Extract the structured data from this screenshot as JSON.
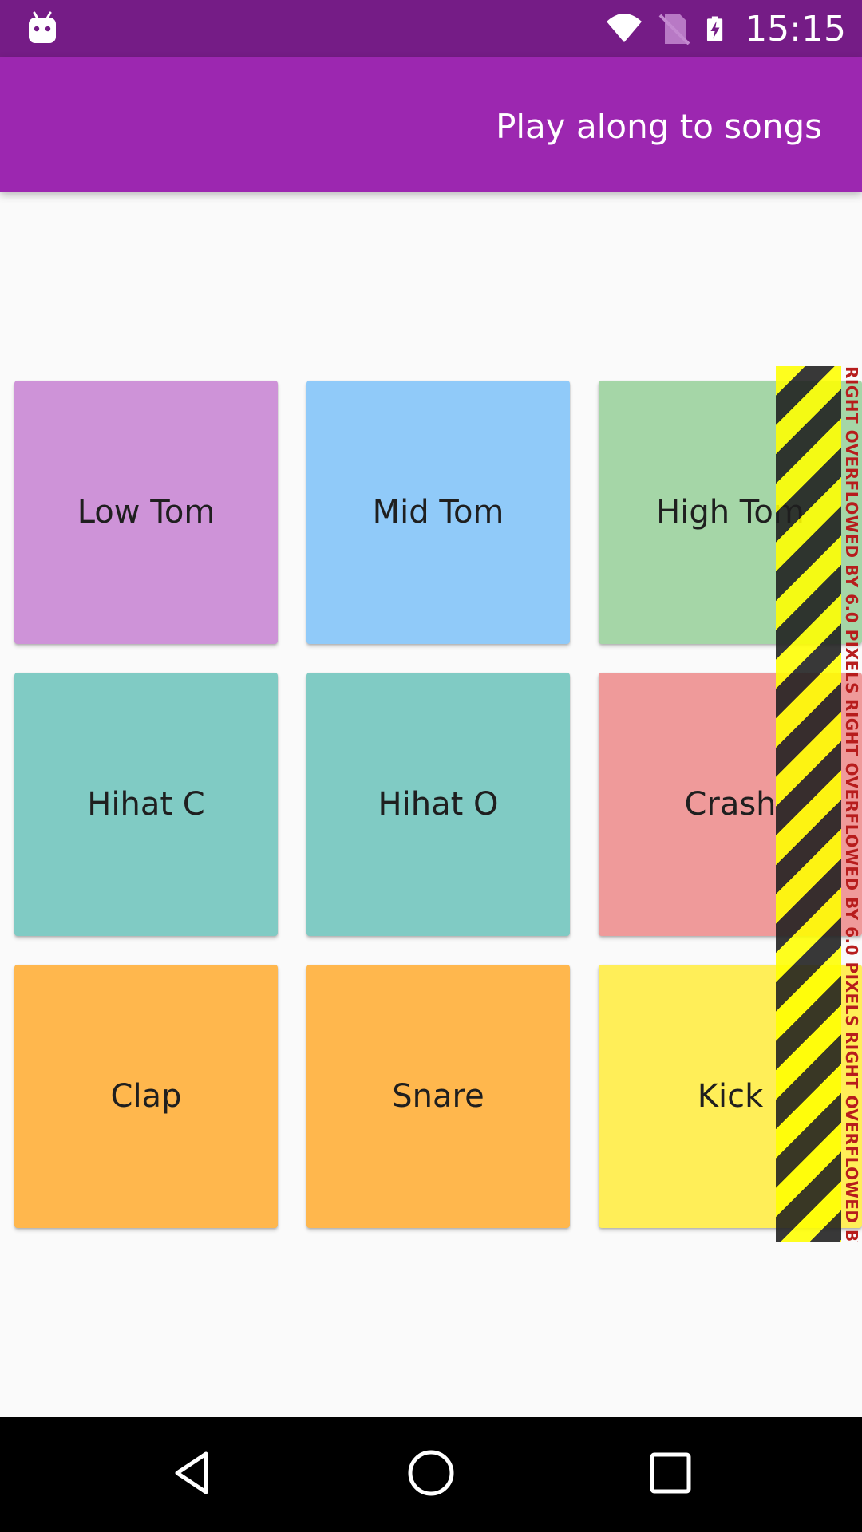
{
  "status_bar": {
    "time": "15:15",
    "icons": [
      "android-icon",
      "wifi-icon",
      "no-sim-icon",
      "battery-charging-icon"
    ],
    "background": "#751c86"
  },
  "app_bar": {
    "title": "Play along to songs",
    "background": "#9c27b0"
  },
  "pads": [
    {
      "label": "Low Tom",
      "color": "#ce93d8"
    },
    {
      "label": "Mid Tom",
      "color": "#90caf9"
    },
    {
      "label": "High Tom",
      "color": "#a5d6a7"
    },
    {
      "label": "Hihat C",
      "color": "#80cbc4"
    },
    {
      "label": "Hihat O",
      "color": "#80cbc4"
    },
    {
      "label": "Crash",
      "color": "#ef9a9a"
    },
    {
      "label": "Clap",
      "color": "#ffb74d"
    },
    {
      "label": "Snare",
      "color": "#ffb74d"
    },
    {
      "label": "Kick",
      "color": "#ffee58"
    }
  ],
  "overflow_warning": {
    "text": "RIGHT OVERFLOWED BY 6.0 PIXELS",
    "stripe_colors": [
      "#ffff00",
      "#1e1e1e"
    ],
    "text_color": "#b71c1c"
  },
  "nav_bar": {
    "buttons": [
      "back-icon",
      "home-icon",
      "recents-icon"
    ]
  }
}
